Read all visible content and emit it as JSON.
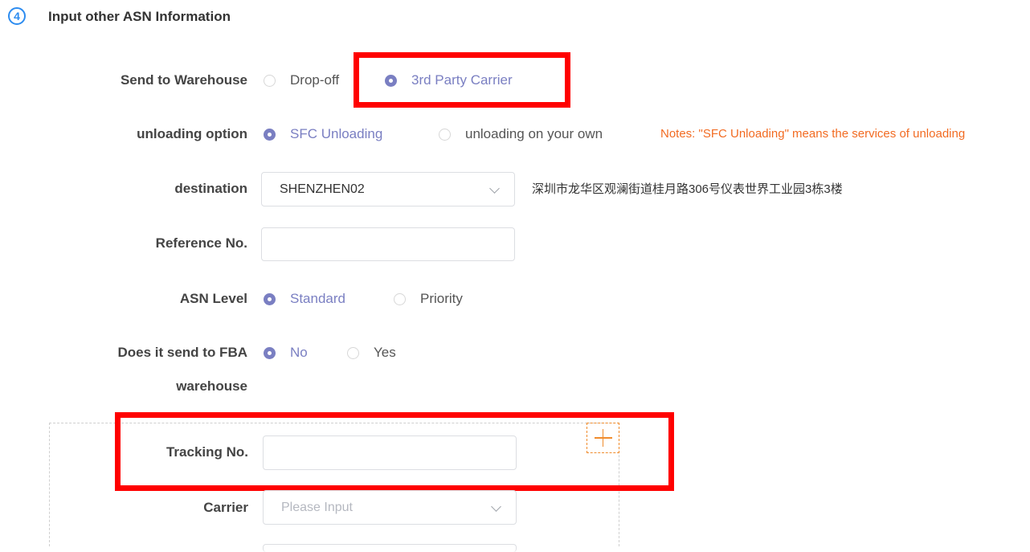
{
  "section": {
    "step": "4",
    "title": "Input other ASN Information"
  },
  "send_to_warehouse": {
    "label": "Send to Warehouse",
    "options": [
      {
        "label": "Drop-off",
        "checked": false
      },
      {
        "label": "3rd Party Carrier",
        "checked": true
      }
    ]
  },
  "unloading": {
    "label": "unloading option",
    "options": [
      {
        "label": "SFC Unloading",
        "checked": true
      },
      {
        "label": "unloading on your own",
        "checked": false
      }
    ],
    "note": "Notes: \"SFC Unloading\" means the services of unloading"
  },
  "destination": {
    "label": "destination",
    "value": "SHENZHEN02",
    "address": "深圳市龙华区观澜街道桂月路306号仪表世界工业园3栋3楼"
  },
  "reference": {
    "label": "Reference No.",
    "value": ""
  },
  "asn_level": {
    "label": "ASN Level",
    "options": [
      {
        "label": "Standard",
        "checked": true
      },
      {
        "label": "Priority",
        "checked": false
      }
    ]
  },
  "fba": {
    "label_line1": "Does it send to FBA",
    "label_line2": "warehouse",
    "options": [
      {
        "label": "No",
        "checked": true
      },
      {
        "label": "Yes",
        "checked": false
      }
    ]
  },
  "tracking": {
    "label": "Tracking No.",
    "value": ""
  },
  "carrier": {
    "label": "Carrier",
    "placeholder": "Please Input"
  },
  "colors": {
    "accent": "#7a7fc2",
    "step": "#2d8cf0",
    "note": "#f26b22",
    "highlight": "#ff0000",
    "add": "#f08c2d"
  }
}
